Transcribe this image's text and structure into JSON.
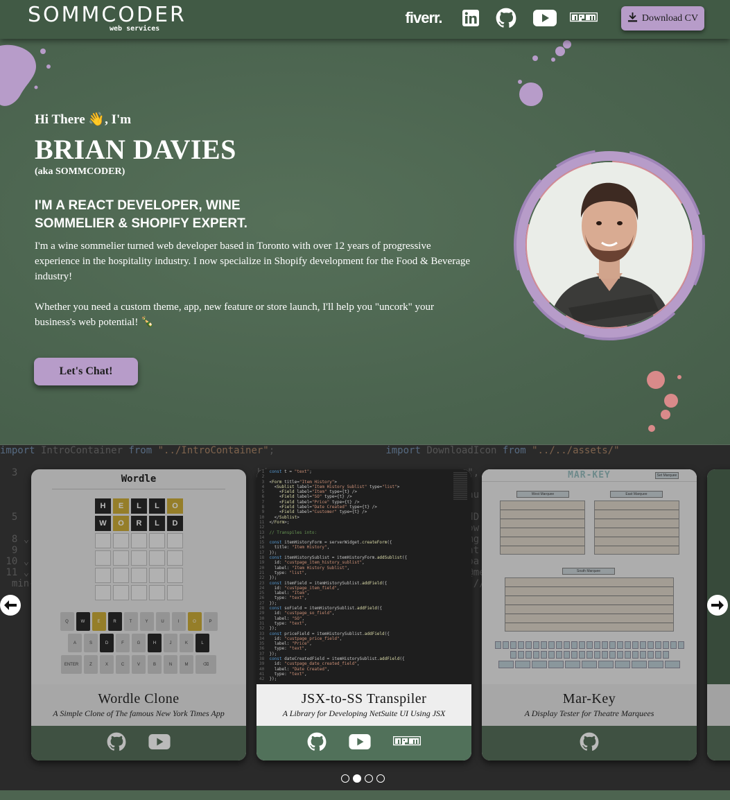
{
  "header": {
    "logo": "SOMMCODER",
    "logo_sub": "web services",
    "social": {
      "fiverr": "fiverr.",
      "linkedin_icon": "linkedin-icon",
      "github_icon": "github-icon",
      "youtube_icon": "youtube-icon",
      "npm": "npm"
    },
    "cv_button": "Download CV"
  },
  "hero": {
    "greeting": "Hi There 👋, I'm",
    "name": "BRIAN DAVIES",
    "aka": "(aka SOMMCODER)",
    "role": "I'M A REACT DEVELOPER, WINE SOMMELIER & SHOPIFY EXPERT.",
    "bio_1": "I'm a wine sommelier turned web developer based in Toronto with over 12 years of progressive experience in the hospitality industry. I now specialize in Shopify development for the Food & Beverage industry!",
    "bio_2": "Whether you need a custom theme, app, new feature or store launch, I'll help you \"uncork\" your business's web potential! 🍾",
    "cta": "Let's Chat!"
  },
  "projects": {
    "cards": [
      {
        "title": "Wordle Clone",
        "subtitle": "A Simple Clone of The famous New York Times App"
      },
      {
        "title": "JSX-to-SS Transpiler",
        "subtitle": "A Library for Developing NetSuite UI Using JSX"
      },
      {
        "title": "Mar-Key",
        "subtitle": "A Display Tester for Theatre Marquees"
      }
    ],
    "wordle": {
      "title": "Wordle",
      "row1": [
        "H",
        "E",
        "L",
        "L",
        "O"
      ],
      "row2": [
        "W",
        "O",
        "R",
        "L",
        "D"
      ],
      "kb_row1": [
        "Q",
        "W",
        "E",
        "R",
        "T",
        "Y",
        "U",
        "I",
        "O",
        "P"
      ],
      "kb_row2": [
        "A",
        "S",
        "D",
        "F",
        "G",
        "H",
        "J",
        "K",
        "L"
      ],
      "kb_row3": [
        "ENTER",
        "Z",
        "X",
        "C",
        "V",
        "B",
        "N",
        "M",
        "⌫"
      ]
    },
    "markey": {
      "title": "MAR-KEY",
      "west": "West Marquee",
      "east": "East Marquee",
      "south": "South Marquee",
      "set": "Set Marquee"
    },
    "active_slide": 2,
    "slide_count": 4
  },
  "colors": {
    "background": "#4d6450",
    "header": "#415a45",
    "accent": "#b79cc9",
    "card_footer": "#4b654e"
  }
}
